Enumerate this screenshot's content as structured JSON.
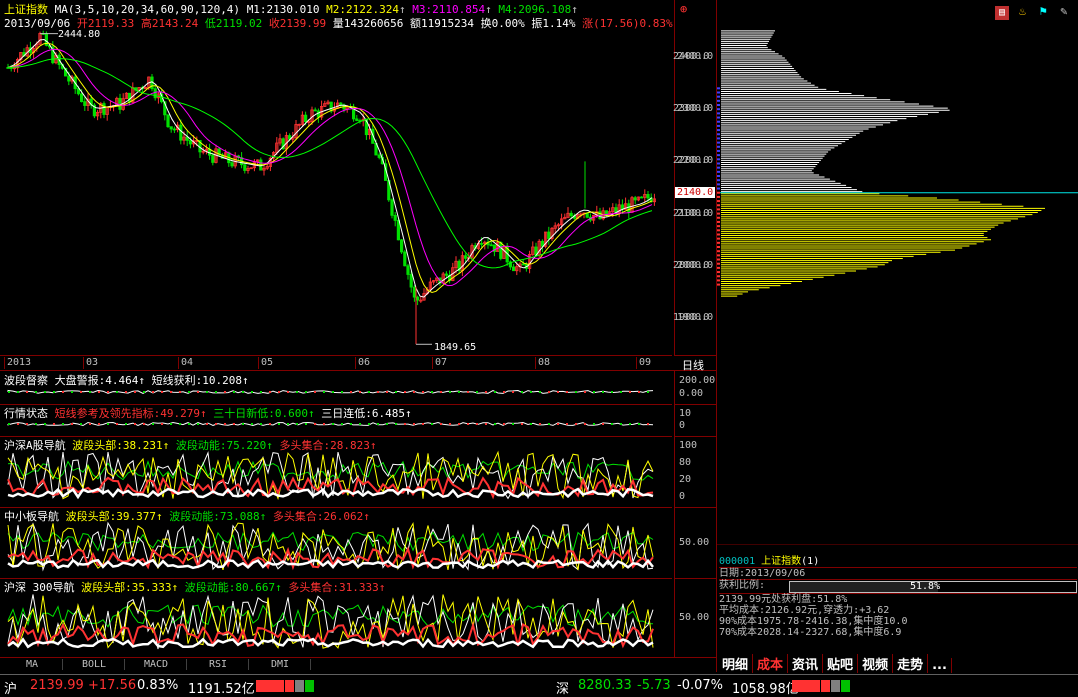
{
  "main_header": {
    "title": "上证指数",
    "ma": "MA(3,5,10,20,34,60,90,120,4)",
    "m1": "M1:2130.010",
    "m2": "M2:2122.324",
    "m3": "M3:2110.854",
    "m4": "M4:2096.108",
    "date": "2013/09/06",
    "open": "开2119.33",
    "high": "高2143.24",
    "low": "低2119.02",
    "close": "收2139.99",
    "volume": "量143260656",
    "amount": "额11915234",
    "turnover": "换0.00%",
    "amplitude": "振1.14%",
    "change": "涨(17.56)0.83%"
  },
  "price_labels": {
    "peak": "2444.80",
    "trough": "1849.65",
    "current": "2140.0"
  },
  "price_axis": [
    "2400.0",
    "2300.0",
    "2200.0",
    "2100.0",
    "2000.0",
    "1900.0"
  ],
  "month_axis": [
    "2013",
    "03",
    "04",
    "05",
    "06",
    "07",
    "08",
    "09"
  ],
  "period_label": "日线",
  "panels": [
    {
      "label": "波段督察",
      "items": [
        {
          "t": "大盘警报:4.464",
          "c": "wht"
        },
        {
          "t": "短线获利:10.208",
          "c": "wht"
        }
      ],
      "ticks": [
        "200.00",
        "0.00"
      ]
    },
    {
      "label": "行情状态",
      "items": [
        {
          "t": "短线参考及领先指标:49.279",
          "c": "red"
        },
        {
          "t": "三十日新低:0.600",
          "c": "grn"
        },
        {
          "t": "三日连低:6.485",
          "c": "wht"
        }
      ],
      "ticks": [
        "10",
        "0"
      ]
    },
    {
      "label": "沪深A股导航",
      "items": [
        {
          "t": "波段头部:38.231",
          "c": "yel"
        },
        {
          "t": "波段动能:75.220",
          "c": "grn"
        },
        {
          "t": "多头集合:28.823",
          "c": "red"
        }
      ],
      "ticks": [
        "100",
        "80",
        "20",
        "0"
      ]
    },
    {
      "label": "中小板导航",
      "items": [
        {
          "t": "波段头部:39.377",
          "c": "yel"
        },
        {
          "t": "波段动能:73.088",
          "c": "grn"
        },
        {
          "t": "多头集合:26.062",
          "c": "red"
        }
      ],
      "ticks": [
        "50.00"
      ]
    },
    {
      "label": "沪深 300导航",
      "items": [
        {
          "t": "波段头部:35.333",
          "c": "yel"
        },
        {
          "t": "波段动能:80.667",
          "c": "grn"
        },
        {
          "t": "多头集合:31.333",
          "c": "red"
        }
      ],
      "ticks": [
        "50.00"
      ]
    }
  ],
  "bottom_tabs": [
    "MA",
    "BOLL",
    "MACD",
    "RSI",
    "DMI"
  ],
  "chip_axis": [
    "2400.0",
    "2300.0",
    "2200.0",
    "2100.0",
    "2000.0",
    "1900.0"
  ],
  "chip_info": {
    "code": "000001",
    "name": "上证指数",
    "num": "(1)",
    "date": "日期:2013/09/06",
    "ratio_label": "获利比例:",
    "ratio_value": "51.8%",
    "ratio_fraction": 0.518,
    "line1": "2139.99元处获利盘:51.8%",
    "line2": "平均成本:2126.92元,穿透力:+3.62",
    "line3": "90%成本1975.78-2416.38,集中度10.0",
    "line4": "70%成本2028.14-2327.68,集中度6.9"
  },
  "right_tabs": [
    "明细",
    "成本",
    "资讯",
    "贴吧",
    "视频",
    "走势",
    "..."
  ],
  "status_bar": {
    "sh_label": "沪",
    "sh_price": "2139.99",
    "sh_change": "+17.56",
    "sh_pct": "0.83%",
    "sh_amount": "1191.52亿",
    "sz_label": "深",
    "sz_price": "8280.33",
    "sz_change": "-5.73",
    "sz_pct": "-0.07%",
    "sz_amount": "1058.98亿"
  },
  "colors": {
    "up": "#ff3232",
    "down": "#00e000",
    "border": "#800000",
    "ma1": "#ffffff",
    "ma2": "#ffff00",
    "ma3": "#ff00ff",
    "ma4": "#00ff00"
  }
}
